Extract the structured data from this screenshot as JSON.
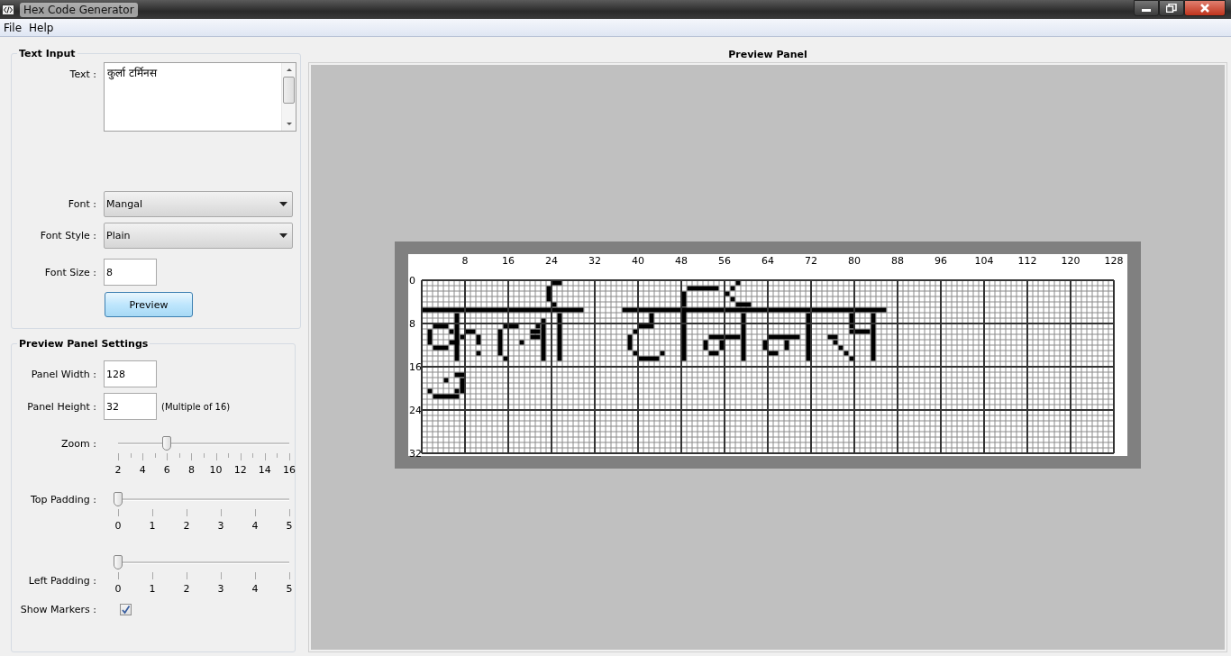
{
  "window": {
    "title": "Hex Code Generator"
  },
  "menu": [
    "File",
    "Help"
  ],
  "text_input": {
    "title": "Text Input",
    "text_label": "Text :",
    "text_value": "कुर्ला टर्मिनस",
    "font_label": "Font :",
    "font_value": "Mangal",
    "font_style_label": "Font Style :",
    "font_style_value": "Plain",
    "font_size_label": "Font Size :",
    "font_size_value": "8",
    "preview_button": "Preview"
  },
  "settings": {
    "title": "Preview Panel Settings",
    "panel_width_label": "Panel Width :",
    "panel_width_value": "128",
    "panel_height_label": "Panel Height :",
    "panel_height_value": "32",
    "panel_height_hint": "(Multiple of 16)",
    "sliders": [
      {
        "label": "Zoom :",
        "level": 0.286,
        "minor_ticks": true,
        "label_below": false,
        "ticks": [
          "2",
          "4",
          "6",
          "8",
          "10",
          "12",
          "14",
          "16"
        ]
      },
      {
        "label": "Top Padding :",
        "level": 0,
        "minor_ticks": false,
        "label_below": false,
        "ticks": [
          "0",
          "1",
          "2",
          "3",
          "4",
          "5"
        ]
      },
      {
        "label": "Left Padding :",
        "level": 0,
        "minor_ticks": false,
        "label_below": true,
        "ticks": [
          "0",
          "1",
          "2",
          "3",
          "4",
          "5"
        ]
      }
    ],
    "show_markers": {
      "label": "Show Markers :",
      "checked": true
    }
  },
  "preview": {
    "title": "Preview Panel",
    "column_markers": [
      "8",
      "16",
      "24",
      "32",
      "40",
      "48",
      "56",
      "64",
      "72",
      "80",
      "88",
      "96",
      "104",
      "112",
      "120",
      "128"
    ],
    "row_markers": [
      "0",
      "8",
      "16",
      "24",
      "32"
    ]
  }
}
